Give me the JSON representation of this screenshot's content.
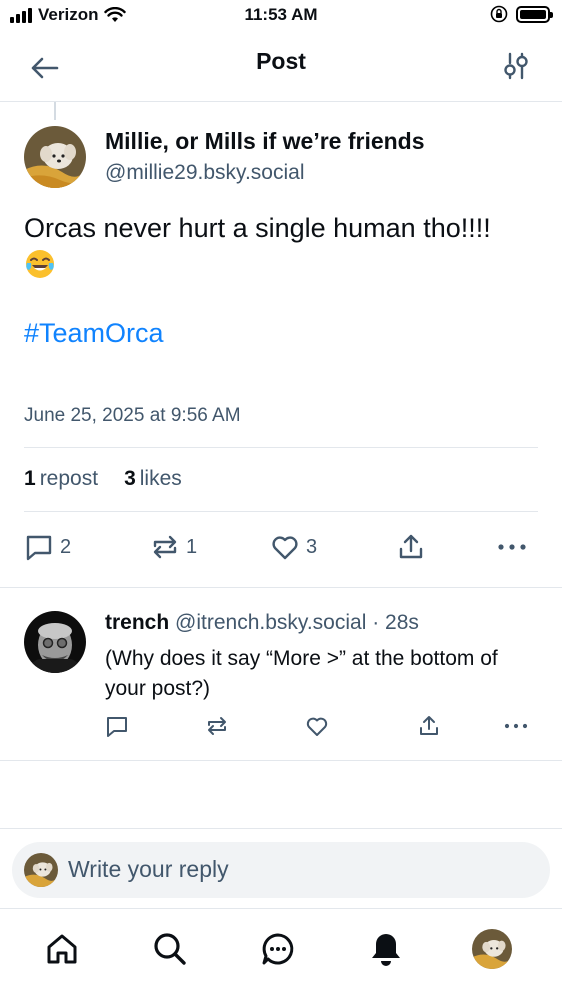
{
  "status_bar": {
    "carrier": "Verizon",
    "time": "11:53 AM"
  },
  "header": {
    "title": "Post"
  },
  "post": {
    "author_name": "Millie, or Mills if we’re friends",
    "author_handle": "@millie29.bsky.social",
    "text": "Orcas never hurt a single human tho!!!!",
    "emoji": "face-with-tears-of-joy",
    "hashtag": "#TeamOrca",
    "date": "June 25, 2025 at 9:56 AM",
    "repost_count": "1",
    "repost_label": "repost",
    "like_count": "3",
    "like_label": "likes",
    "actions": {
      "replies": "2",
      "reposts": "1",
      "likes": "3"
    }
  },
  "reply": {
    "author_name": "trench",
    "author_handle": "@itrench.bsky.social",
    "time": "· 28s",
    "text": "(Why does it say “More >” at the bottom of your post?)"
  },
  "compose": {
    "placeholder": "Write your reply"
  },
  "colors": {
    "accent": "#1083fe",
    "muted": "#42576c",
    "divider": "#e3e7ec"
  }
}
